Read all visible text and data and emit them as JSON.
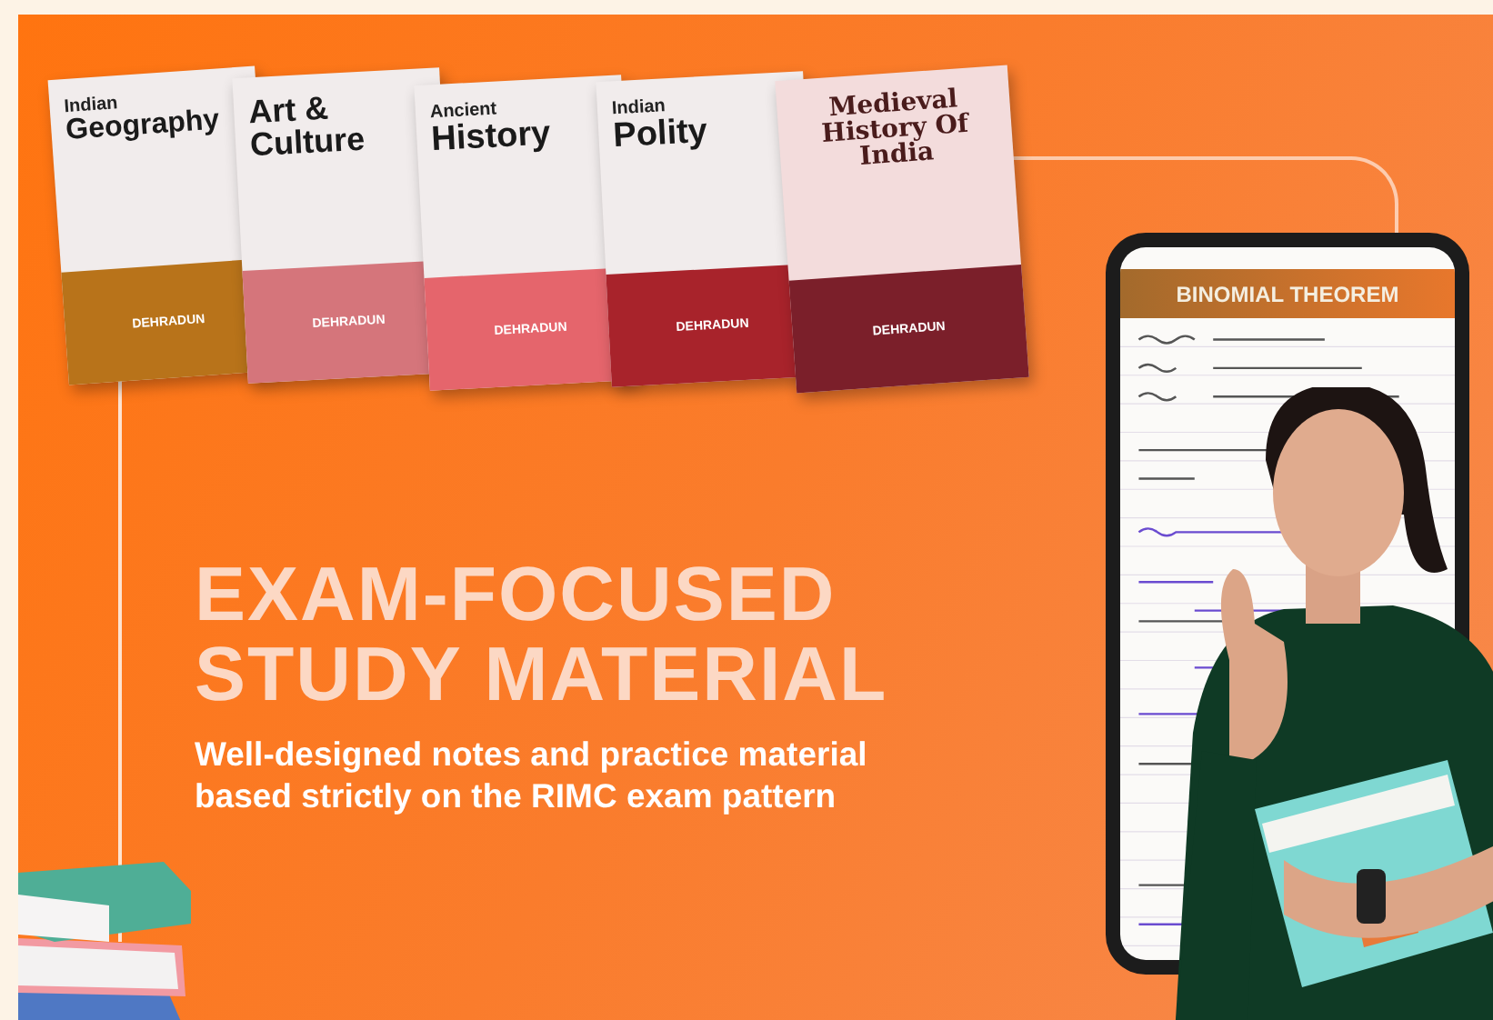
{
  "banner": {
    "books": [
      {
        "series": "Indian",
        "title": "Geography",
        "publisher": "DEHRADUN",
        "color": "#b8731a"
      },
      {
        "title": "Art & Culture",
        "publisher": "DEHRADUN",
        "color": "#d5757b"
      },
      {
        "series": "Ancient",
        "title": "History",
        "publisher": "DEHRADUN",
        "color": "#e5656c"
      },
      {
        "series": "Indian",
        "title": "Polity",
        "publisher": "DEHRADUN",
        "color": "#a8232b"
      },
      {
        "kind": "serif",
        "title": "Medieval History Of India",
        "publisher": "DEHRADUN",
        "color": "#7b1f2a"
      }
    ],
    "phone": {
      "header": "BINOMIAL THEOREM"
    },
    "headline": [
      "EXAM-FOCUSED",
      "STUDY MATERIAL"
    ],
    "subtitle": "Well-designed notes and practice material based strictly on the RIMC exam pattern"
  }
}
